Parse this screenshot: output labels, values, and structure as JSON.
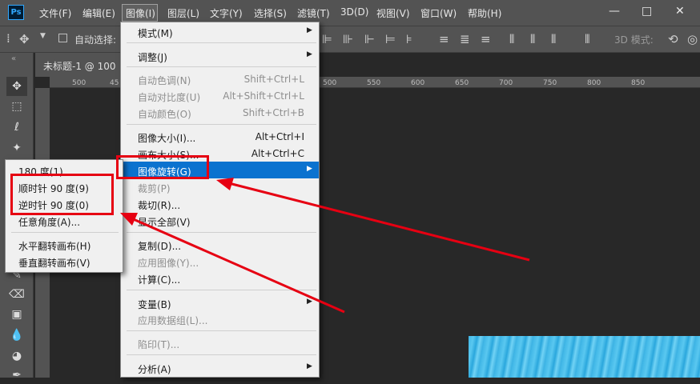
{
  "menubar": {
    "logo": "Ps",
    "items": [
      "文件(F)",
      "编辑(E)",
      "图像(I)",
      "图层(L)",
      "文字(Y)",
      "选择(S)",
      "滤镜(T)",
      "3D(D)",
      "视图(V)",
      "窗口(W)",
      "帮助(H)"
    ],
    "window_buttons": [
      "—",
      "□",
      "✕"
    ]
  },
  "options_bar": {
    "auto_select_label": "自动选择:",
    "mode_3d_label": "3D 模式:"
  },
  "document": {
    "tab_title": "未标题-1 @ 100",
    "ruler_ticks": [
      "500",
      "45",
      "500",
      "550",
      "600",
      "650",
      "700",
      "750",
      "800",
      "850"
    ]
  },
  "image_menu": {
    "items": [
      {
        "label": "模式(M)",
        "shortcut": "",
        "disabled": false,
        "submenu": true
      },
      {
        "label": "调整(J)",
        "shortcut": "",
        "disabled": false,
        "submenu": true
      },
      {
        "label": "自动色调(N)",
        "shortcut": "Shift+Ctrl+L",
        "disabled": true
      },
      {
        "label": "自动对比度(U)",
        "shortcut": "Alt+Shift+Ctrl+L",
        "disabled": true
      },
      {
        "label": "自动颜色(O)",
        "shortcut": "Shift+Ctrl+B",
        "disabled": true
      },
      {
        "label": "图像大小(I)...",
        "shortcut": "Alt+Ctrl+I",
        "disabled": false
      },
      {
        "label": "画布大小(S)...",
        "shortcut": "Alt+Ctrl+C",
        "disabled": false
      },
      {
        "label": "图像旋转(G)",
        "shortcut": "",
        "disabled": false,
        "submenu": true,
        "highlighted": true
      },
      {
        "label": "裁剪(P)",
        "shortcut": "",
        "disabled": true
      },
      {
        "label": "裁切(R)...",
        "shortcut": "",
        "disabled": false
      },
      {
        "label": "显示全部(V)",
        "shortcut": "",
        "disabled": false
      },
      {
        "label": "复制(D)...",
        "shortcut": "",
        "disabled": false
      },
      {
        "label": "应用图像(Y)...",
        "shortcut": "",
        "disabled": true
      },
      {
        "label": "计算(C)...",
        "shortcut": "",
        "disabled": false
      },
      {
        "label": "变量(B)",
        "shortcut": "",
        "disabled": false,
        "submenu": true
      },
      {
        "label": "应用数据组(L)...",
        "shortcut": "",
        "disabled": true
      },
      {
        "label": "陷印(T)...",
        "shortcut": "",
        "disabled": true
      },
      {
        "label": "分析(A)",
        "shortcut": "",
        "disabled": false,
        "submenu": true
      }
    ]
  },
  "rotation_submenu": {
    "items": [
      "180 度(1)",
      "顺时针 90 度(9)",
      "逆时针 90 度(0)",
      "任意角度(A)...",
      "水平翻转画布(H)",
      "垂直翻转画布(V)"
    ]
  },
  "colors": {
    "highlight": "#0b72cf",
    "annotation_red": "#e60012",
    "menubar_bg": "#535353",
    "canvas_bg": "#282828"
  }
}
